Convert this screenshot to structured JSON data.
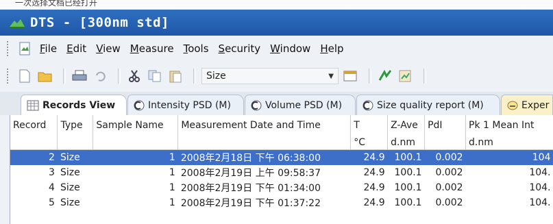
{
  "top_text": "一次选择文档已经打开",
  "window": {
    "title": "DTS - [300nm std]"
  },
  "menu": [
    {
      "label": "File",
      "u": "F",
      "rest": "ile"
    },
    {
      "label": "Edit",
      "u": "E",
      "rest": "dit"
    },
    {
      "label": "View",
      "u": "V",
      "rest": "iew"
    },
    {
      "label": "Measure",
      "u": "M",
      "rest": "easure"
    },
    {
      "label": "Tools",
      "u": "T",
      "rest": "ools"
    },
    {
      "label": "Security",
      "u": "S",
      "rest": "ecurity"
    },
    {
      "label": "Window",
      "u": "W",
      "rest": "indow"
    },
    {
      "label": "Help",
      "u": "H",
      "rest": "elp"
    }
  ],
  "toolbar": {
    "size_value": "Size",
    "icons": [
      "new-icon",
      "open-icon",
      "print-icon",
      "undo-icon",
      "cut-icon",
      "copy-icon",
      "paste-icon"
    ]
  },
  "tabs": [
    {
      "label": "Records View"
    },
    {
      "label": "Intensity PSD (M)"
    },
    {
      "label": "Volume PSD (M)"
    },
    {
      "label": "Size quality report (M)"
    },
    {
      "label": "Exper"
    }
  ],
  "table": {
    "headers": [
      "Record",
      "Type",
      "Sample Name",
      "Measurement Date and Time",
      "T",
      "Z-Ave",
      "PdI",
      "Pk 1 Mean Int"
    ],
    "units": [
      "",
      "",
      "",
      "",
      "°C",
      "d.nm",
      "",
      "d.nm"
    ],
    "rows": [
      [
        "2",
        "Size",
        "1",
        "2008年2月18日 下午 06:38:00",
        "24.9",
        "100.1",
        "0.002",
        "104"
      ],
      [
        "3",
        "Size",
        "1",
        "2008年2月19日 上午 09:58:37",
        "24.9",
        "100.1",
        "0.002",
        "104."
      ],
      [
        "4",
        "Size",
        "1",
        "2008年2月19日 下午 01:34:00",
        "24.9",
        "100.1",
        "0.002",
        "104."
      ],
      [
        "5",
        "Size",
        "1",
        "2008年2月19日 下午 01:37:22",
        "24.9",
        "100.1",
        "0.002",
        "104."
      ]
    ]
  },
  "colors": {
    "titlebar": "#1f57a8",
    "selection": "#3d6fc8"
  }
}
